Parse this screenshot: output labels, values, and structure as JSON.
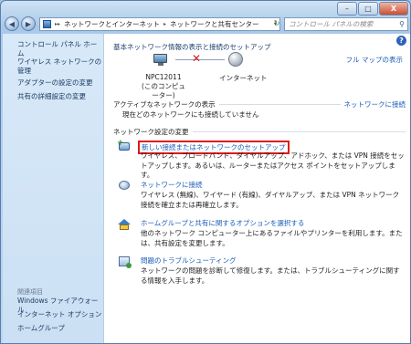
{
  "window": {
    "minimize_glyph": "–",
    "maximize_glyph": "□",
    "close_glyph": "X"
  },
  "addressbar": {
    "crumbs": [
      "ネットワークとインターネット",
      "ネットワークと共有センター"
    ],
    "search_placeholder": "コントロール パネルの検索"
  },
  "sidebar": {
    "items": [
      {
        "label": "コントロール パネル ホーム"
      },
      {
        "label": "ワイヤレス ネットワークの管理"
      },
      {
        "label": "アダプターの設定の変更"
      },
      {
        "label": "共有の詳細設定の変更"
      }
    ],
    "related_header": "関連項目",
    "related": [
      {
        "label": "Windows ファイアウォール"
      },
      {
        "label": "インターネット オプション"
      },
      {
        "label": "ホームグループ"
      }
    ]
  },
  "main": {
    "heading": "基本ネットワーク情報の表示と接続のセットアップ",
    "full_map": "フル マップの表示",
    "pc_name": "NPC12011",
    "pc_sub": "(このコンピューター)",
    "internet_label": "インターネット",
    "active_header": "アクティブなネットワークの表示",
    "connect_link": "ネットワークに接続",
    "not_connected": "現在どのネットワークにも接続していません",
    "settings_header": "ネットワーク設定の変更",
    "tasks": [
      {
        "link": "新しい接続またはネットワークのセットアップ",
        "desc": "ワイヤレス、ブロードバンド、ダイヤルアップ、アドホック、または VPN 接続をセットアップします。あるいは、ルーターまたはアクセス ポイントをセットアップします。"
      },
      {
        "link": "ネットワークに接続",
        "desc": "ワイヤレス (無線)、ワイヤード (有線)、ダイヤルアップ、または VPN ネットワーク接続を確立または再確立します。"
      },
      {
        "link": "ホームグループと共有に関するオプションを選択する",
        "desc": "他のネットワーク コンピューター上にあるファイルやプリンターを利用します。または、共有設定を変更します。"
      },
      {
        "link": "問題のトラブルシューティング",
        "desc": "ネットワークの問題を診断して修復します。または、トラブルシューティングに関する情報を入手します。"
      }
    ]
  }
}
